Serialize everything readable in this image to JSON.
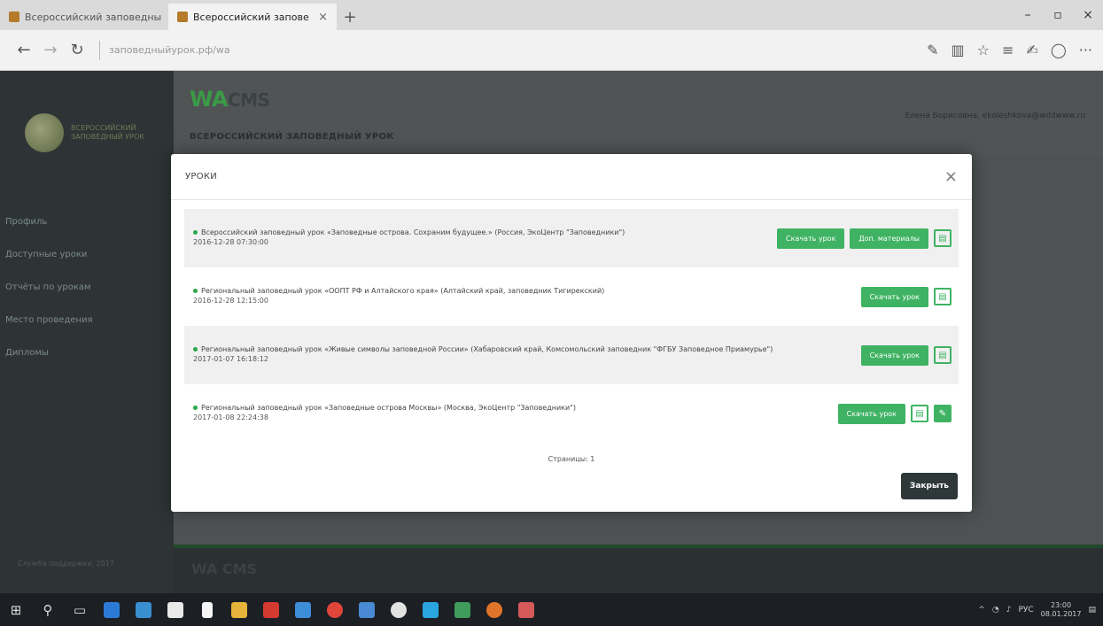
{
  "browser": {
    "tabs": [
      {
        "title": "Всероссийский заповедны"
      },
      {
        "title": "Всероссийский запове"
      }
    ],
    "tab_close": "×",
    "new_tab": "+",
    "window_controls": {
      "minimize": "–",
      "restore": "▫",
      "close": "×"
    },
    "nav": {
      "back": "←",
      "forward": "→",
      "refresh": "↻"
    },
    "url": "заповедныйурок.рф/wa",
    "tools": [
      "✎",
      "▥",
      "☆",
      "≡",
      "✍",
      "◯",
      "···"
    ]
  },
  "app": {
    "brand_wa": "WA",
    "brand_cms": "CMS",
    "subtitle": "ВСЕРОССИЙСКИЙ ЗАПОВЕДНЫЙ УРОК",
    "user": "Елена Борисовна, ekoleshkova@wildwww.ru",
    "logo_text": "ВСЕРОССИЙСКИЙ ЗАПОВЕДНЫЙ УРОК",
    "sidebar_items": [
      "Профиль",
      "Доступные уроки",
      "Отчёты по урокам",
      "Место проведения",
      "Дипломы"
    ],
    "footer_left": "Служба поддержки, 2017",
    "footer_brand": "WA CMS"
  },
  "modal": {
    "title": "УРОКИ",
    "close_icon": "×",
    "lessons": [
      {
        "title": "Всероссийский заповедный урок «Заповедные острова. Сохраним будущее.» (Россия, ЭкоЦентр \"Заповедники\")",
        "date": "2016-12-28 07:30:00",
        "download": "Скачать урок",
        "materials": "Доп. материалы"
      },
      {
        "title": "Региональный заповедный урок «ООПТ РФ и Алтайского края» (Алтайский край, заповедник Тигирекский)",
        "date": "2016-12-28 12:15:00",
        "download": "Скачать урок"
      },
      {
        "title": "Региональный заповедный урок «Живые символы заповедной России» (Хабаровский край, Комсомольский заповедник \"ФГБУ Заповедное Приамурье\")",
        "date": "2017-01-07 16:18:12",
        "download": "Скачать урок"
      },
      {
        "title": "Региональный заповедный урок «Заповедные острова Москвы» (Москва, ЭкоЦентр \"Заповедники\")",
        "date": "2017-01-08 22:24:38",
        "download": "Скачать урок"
      }
    ],
    "pages_label": "Страницы: 1",
    "close_button": "Закрыть"
  },
  "taskbar": {
    "tray_text": "РУС",
    "time": "23:00",
    "date": "08.01.2017"
  }
}
